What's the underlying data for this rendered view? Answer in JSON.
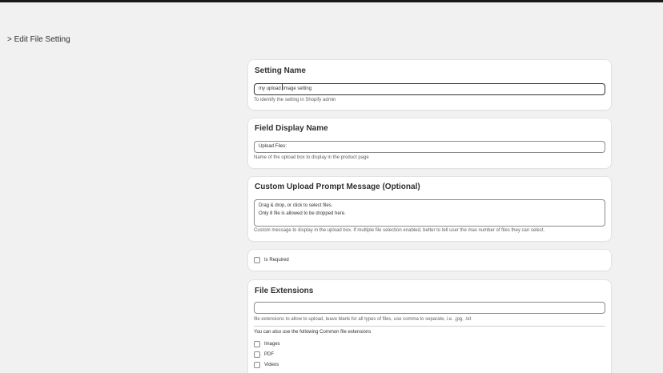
{
  "breadcrumb": "> Edit File Setting",
  "setting_name": {
    "title": "Setting Name",
    "value_before_cursor": "my upload ",
    "value_after_cursor": "image setting",
    "help": "To identify the setting in Shopify admin"
  },
  "field_display_name": {
    "title": "Field Display Name",
    "value": "Upload Files:",
    "help": "Name of the upload box to display in the product page"
  },
  "custom_prompt": {
    "title": "Custom Upload Prompt Message (Optional)",
    "line1": "Drag & drop, or click to select files.",
    "line2": "Only 8 file is allowed to be dropped here.",
    "help": "Custom message to display in the upload box. If multiple file selection enabled, better to tell user the max number of files they can select."
  },
  "required": {
    "label": "Is Required"
  },
  "file_extensions": {
    "title": "File Extensions",
    "value": "",
    "help": "file extensions to allow to upload, leave blank for all types of files, use comma to separate, i.e. .jpg, .txt",
    "common_label": "You can also use the following Common file extensions",
    "options": [
      "Images",
      "PDF",
      "Videos"
    ]
  }
}
